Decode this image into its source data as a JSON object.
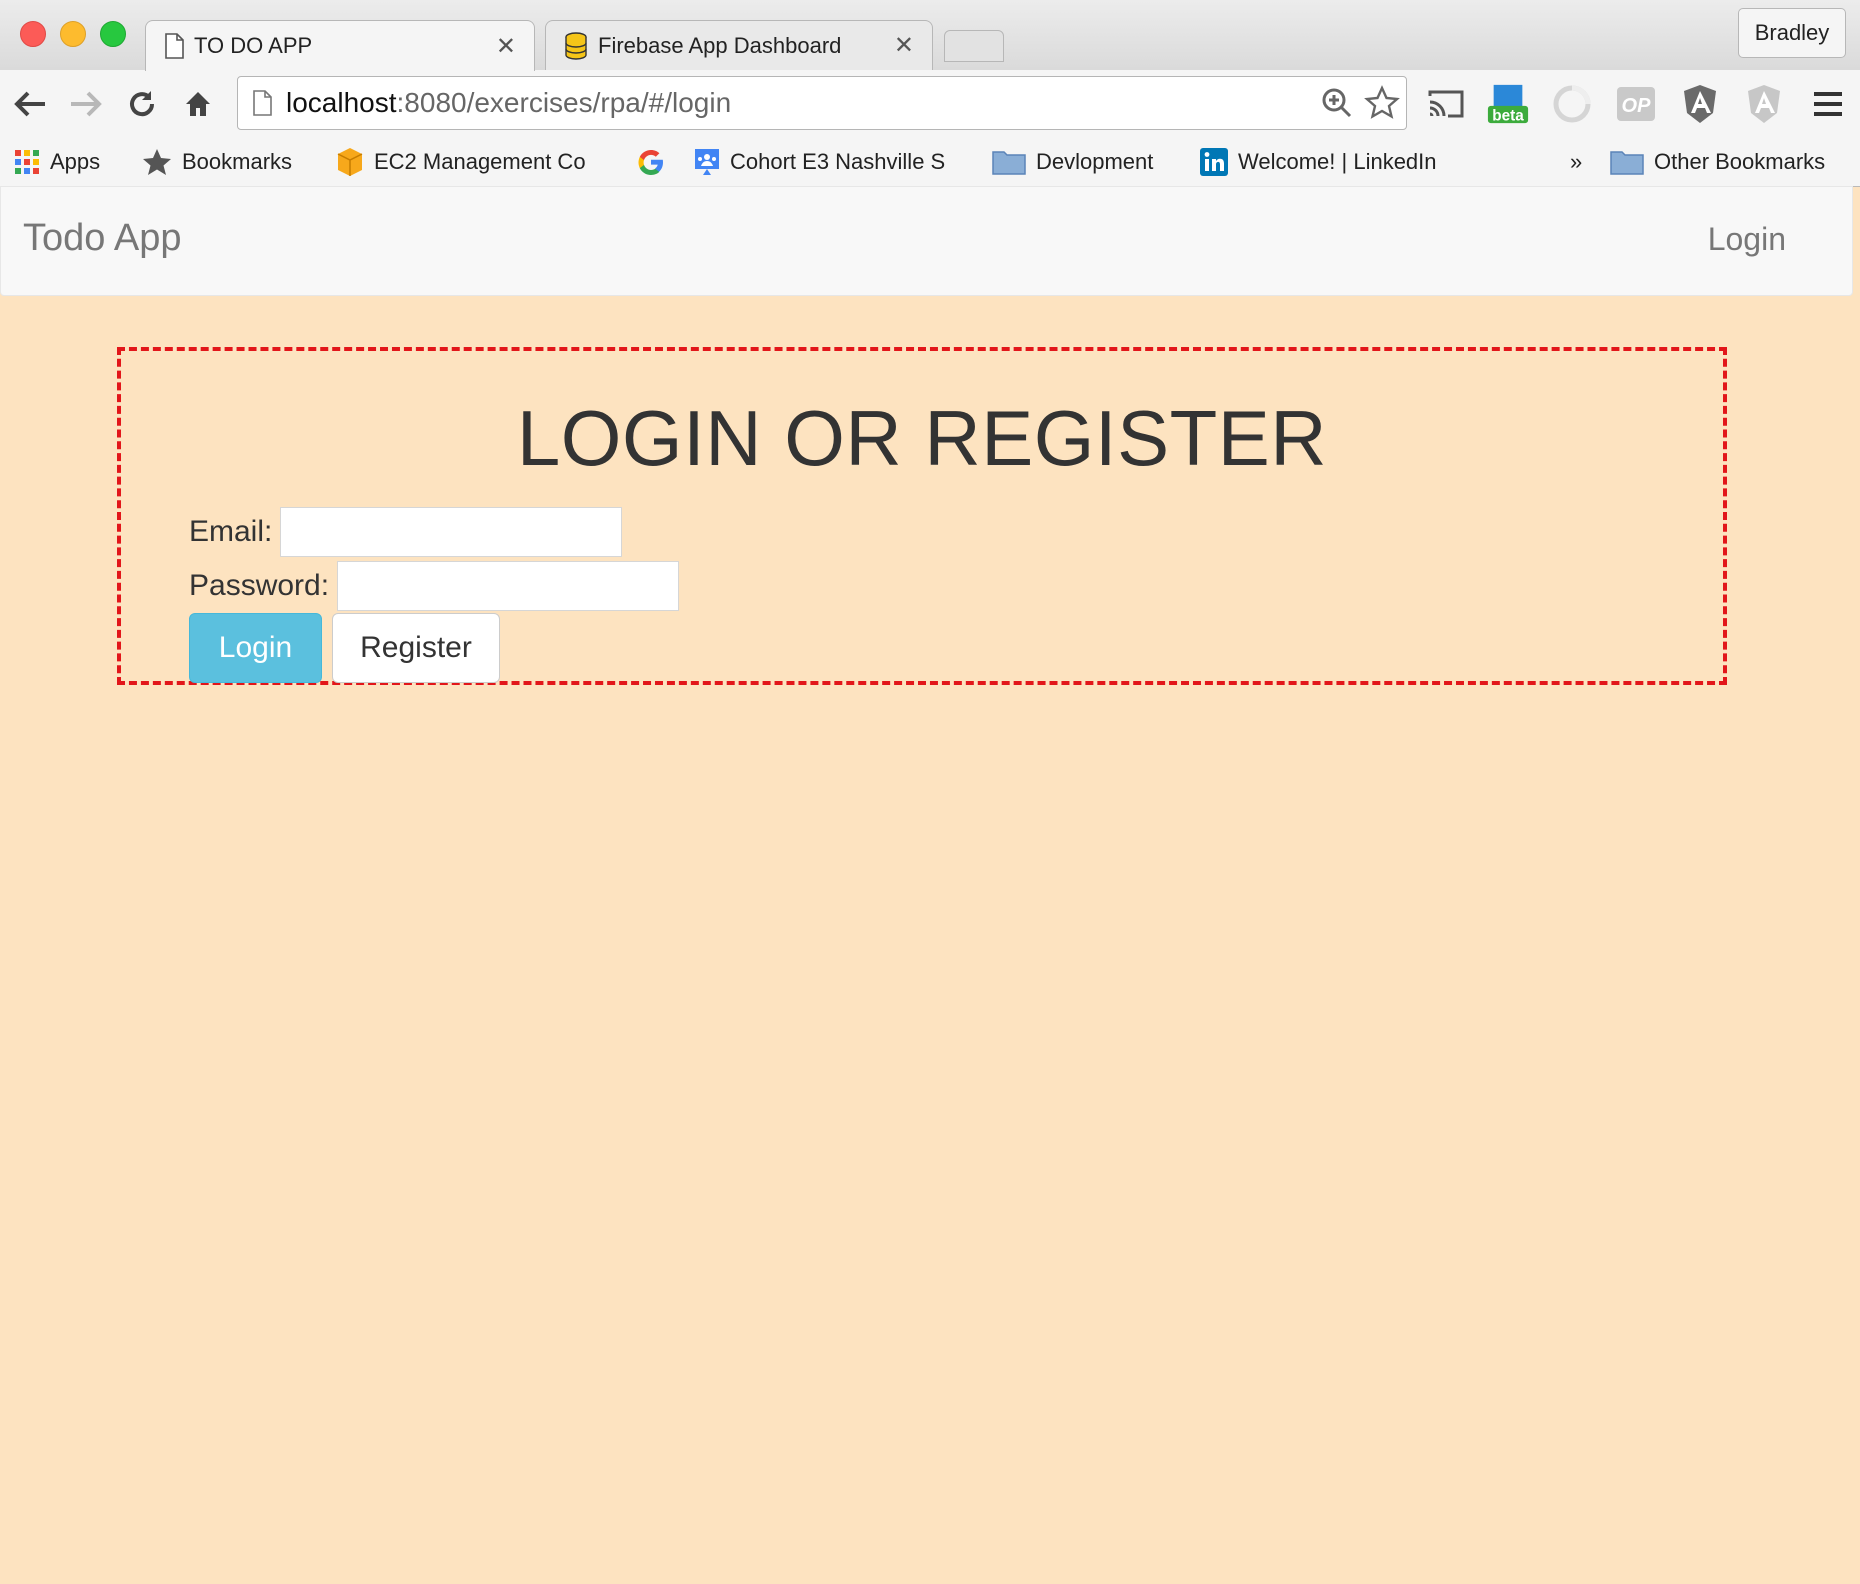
{
  "browser": {
    "tabs": [
      {
        "title": "TO DO APP",
        "icon": "page-icon",
        "active": true
      },
      {
        "title": "Firebase App Dashboard",
        "icon": "firebase-icon",
        "active": false
      }
    ],
    "profile": "Bradley",
    "url": {
      "host": "localhost",
      "path": ":8080/exercises/rpa/#/login"
    },
    "bookmarks": {
      "apps": "Apps",
      "bookmarks": "Bookmarks",
      "ec2": "EC2 Management Co",
      "cohort": "Cohort E3 Nashville S",
      "devlopment": "Devlopment",
      "linkedin": "Welcome! | LinkedIn",
      "overflow": "»",
      "other": "Other Bookmarks"
    },
    "extensions": {
      "beta": "beta",
      "op": "OP"
    }
  },
  "navbar": {
    "brand": "Todo App",
    "login": "Login"
  },
  "form": {
    "heading": "LOGIN OR REGISTER",
    "email_label": "Email:",
    "email_value": "",
    "password_label": "Password:",
    "password_value": "",
    "login_button": "Login",
    "register_button": "Register"
  },
  "colors": {
    "page_background": "#fde3c0",
    "panel_border": "#e2161a",
    "login_button": "#5bc0de"
  }
}
